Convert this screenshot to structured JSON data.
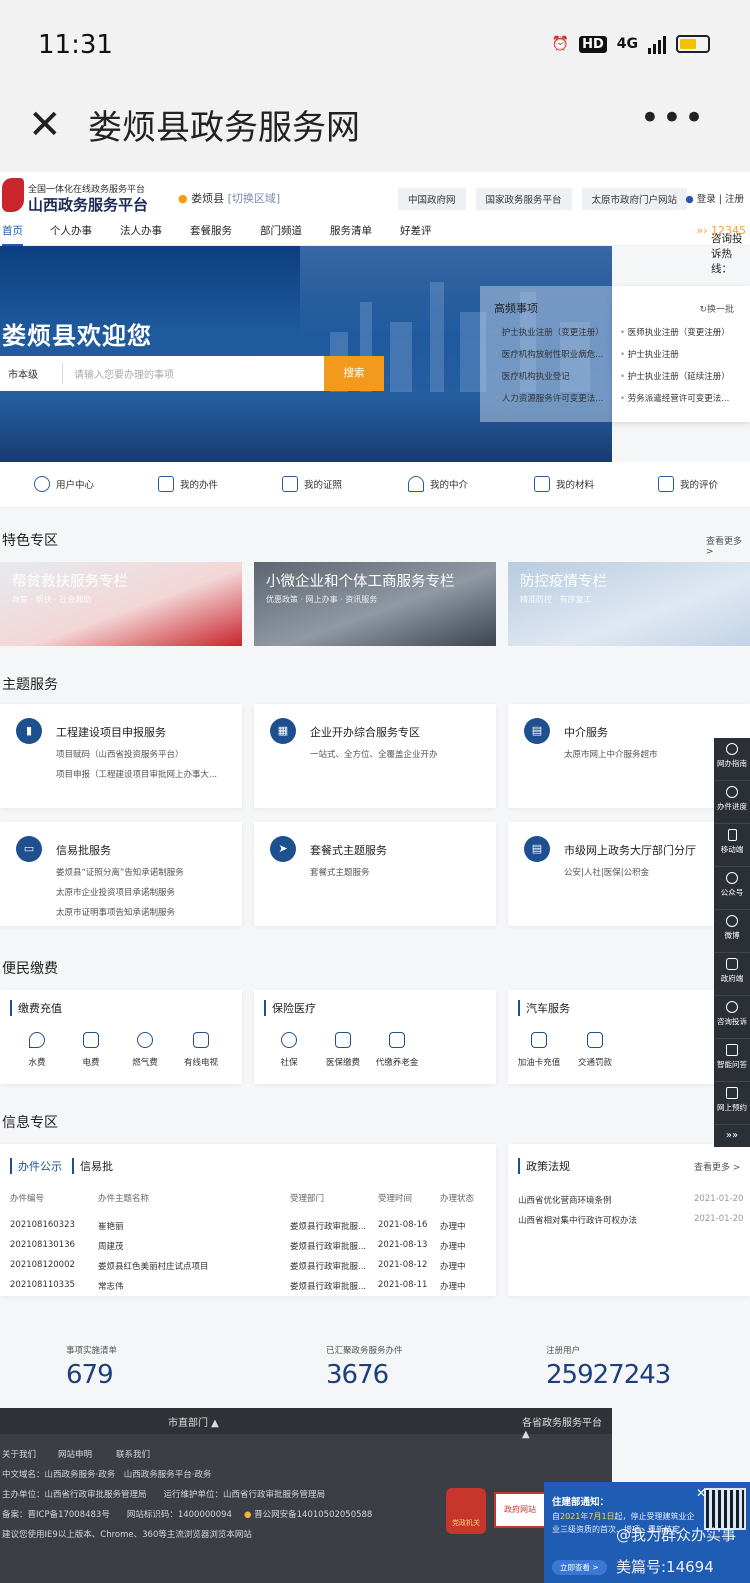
{
  "status_bar": {
    "time": "11:31",
    "network": "4G",
    "hd": "HD"
  },
  "title_bar": {
    "title": "娄烦县政务服务网"
  },
  "site_header": {
    "platform_sub": "全国一体化在线政务服务平台",
    "platform_name": "山西政务服务平台",
    "location": "娄烦县",
    "switch_region": "[切换区域]",
    "top_links": [
      "中国政府网",
      "国家政务服务平台",
      "太原市政府门户网站"
    ],
    "login": "登录 | 注册"
  },
  "nav": {
    "items": [
      "首页",
      "个人办事",
      "法人办事",
      "套餐服务",
      "部门频道",
      "服务清单",
      "好差评"
    ],
    "hotline_label": "咨询投诉热线：",
    "hotline_number": "12345"
  },
  "banner": {
    "welcome": "娄烦县欢迎您",
    "search_scope": "市本级",
    "search_placeholder": "请输入您要办理的事项",
    "search_button": "搜索"
  },
  "hot_items": {
    "title": "高频事项",
    "refresh": "换一批",
    "left": [
      "护士执业注册（变更注册）",
      "医疗机构放射性职业病危...",
      "医疗机构执业登记",
      "人力资源服务许可变更法..."
    ],
    "right": [
      "医师执业注册（变更注册）",
      "护士执业注册",
      "护士执业注册（延续注册）",
      "劳务派遣经营许可变更法..."
    ]
  },
  "quick_links": [
    "用户中心",
    "我的办件",
    "我的证照",
    "我的中介",
    "我的材料",
    "我的评价"
  ],
  "featured": {
    "title": "特色专区",
    "more": "查看更多 >",
    "cards": [
      {
        "title": "帮贫救扶服务专栏",
        "sub": "政策 · 帮扶 · 社会救助"
      },
      {
        "title": "小微企业和个体工商服务专栏",
        "sub": "优惠政策 · 网上办事 · 资讯服务"
      },
      {
        "title": "防控疫情专栏",
        "sub": "精准防控 · 有序复工"
      }
    ]
  },
  "topic_services": {
    "title": "主题服务",
    "cards": [
      {
        "title": "工程建设项目申报服务",
        "lines": [
          "项目赋码（山西省投资服务平台）",
          "项目申报（工程建设项目审批网上办事大..."
        ]
      },
      {
        "title": "企业开办综合服务专区",
        "lines": [
          "一站式、全方位、全覆盖企业开办"
        ]
      },
      {
        "title": "中介服务",
        "lines": [
          "太原市网上中介服务超市"
        ]
      },
      {
        "title": "信易批服务",
        "lines": [
          "娄烦县“证照分离”告知承诺制服务",
          "太原市企业投资项目承诺制服务",
          "太原市证明事项告知承诺制服务"
        ]
      },
      {
        "title": "套餐式主题服务",
        "lines": [
          "套餐式主题服务"
        ]
      },
      {
        "title": "市级网上政务大厅部门分厅",
        "lines": [
          "公安|人社|医保|公积金"
        ]
      }
    ]
  },
  "payments": {
    "title": "便民缴费",
    "groups": [
      {
        "title": "缴费充值",
        "items": [
          "水费",
          "电费",
          "燃气费",
          "有线电视"
        ]
      },
      {
        "title": "保险医疗",
        "items": [
          "社保",
          "医保缴费",
          "代缴养老金"
        ]
      },
      {
        "title": "汽车服务",
        "items": [
          "加油卡充值",
          "交通罚款"
        ]
      }
    ]
  },
  "info": {
    "title": "信息专区",
    "tabs": [
      "办件公示",
      "信易批"
    ],
    "headers": [
      "办件编号",
      "办件主题名称",
      "受理部门",
      "受理时间",
      "办理状态"
    ],
    "rows": [
      [
        "202108160323",
        "崔艳丽",
        "娄烦县行政审批服...",
        "2021-08-16",
        "办理中"
      ],
      [
        "202108130136",
        "周建茂",
        "娄烦县行政审批服...",
        "2021-08-13",
        "办理中"
      ],
      [
        "202108120002",
        "娄烦县红色美丽村庄试点项目",
        "娄烦县行政审批服...",
        "2021-08-12",
        "办理中"
      ],
      [
        "202108110335",
        "常志伟",
        "娄烦县行政审批服...",
        "2021-08-11",
        "办理中"
      ]
    ],
    "policy_title": "政策法规",
    "policy_more": "查看更多 >",
    "policies": [
      {
        "name": "山西省优化营商环境条例",
        "date": "2021-01-20"
      },
      {
        "name": "山西省相对集中行政许可权办法",
        "date": "2021-01-20"
      }
    ]
  },
  "stats": [
    {
      "label": "事项实施清单",
      "value": "679"
    },
    {
      "label": "已汇聚政务服务办件",
      "value": "3676"
    },
    {
      "label": "注册用户",
      "value": "25927243"
    }
  ],
  "footer": {
    "dept": "市直部门 ▲",
    "halls": "各省政务服务平台 ▲",
    "links": [
      "关于我们",
      "网站申明",
      "联系我们"
    ],
    "domain": "中文域名：山西政务服务·政务　山西政务服务平台·政务",
    "host": "主办单位：山西省行政审批服务管理局　　运行维护单位：山西省行政审批服务管理局",
    "icp": "备案：晋ICP备17008483号　　网站标识码：1400000094",
    "security": "晋公网安备14010502050588",
    "browser": "建议您使用IE9以上版本、Chrome、360等主流浏览器浏览本网站",
    "badge1": "党政机关",
    "badge2": "政府网站"
  },
  "sidebar": [
    "网办指南",
    "办件进度",
    "移动端",
    "公众号",
    "微博",
    "政府端",
    "咨询投诉",
    "智能问答",
    "网上预约"
  ],
  "notice": {
    "title": "住建部通知：",
    "body_pre": "自",
    "date": "2021年7月1日",
    "body_post": "起，停止受理建筑业企业三级资质的首次、增项、重新核定",
    "button": "立即查看 >"
  },
  "watermark": {
    "line1": "@我为群众办实事",
    "line2": "美篇号:14694"
  }
}
